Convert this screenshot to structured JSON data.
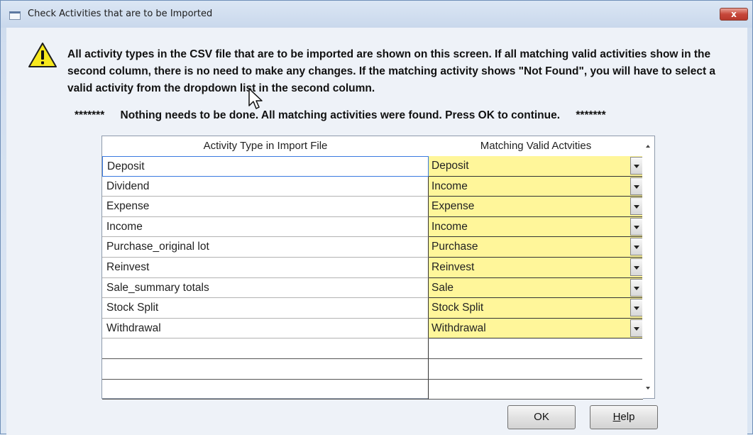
{
  "window": {
    "title": "Check Activities that are to be Imported",
    "close_label": "x"
  },
  "message": {
    "text": "All activity types in the CSV file that are to be imported are shown on this screen. If all matching valid activities show in the second column, there is no need to make any changes. If the matching activity shows \"Not Found\", you will have to select a valid activity from the dropdown list in the second column."
  },
  "status": {
    "left_stars": "*******",
    "text": "Nothing needs to be done. All matching activities were found. Press OK to continue.",
    "right_stars": "*******"
  },
  "grid": {
    "columns": [
      "Activity Type in Import File",
      "Matching Valid Actvities"
    ],
    "rows": [
      {
        "import": "Deposit",
        "match": "Deposit"
      },
      {
        "import": "Dividend",
        "match": "Income"
      },
      {
        "import": "Expense",
        "match": "Expense"
      },
      {
        "import": "Income",
        "match": "Income"
      },
      {
        "import": "Purchase_original lot",
        "match": "Purchase"
      },
      {
        "import": "Reinvest",
        "match": "Reinvest"
      },
      {
        "import": "Sale_summary totals",
        "match": "Sale"
      },
      {
        "import": "Stock Split",
        "match": "Stock Split"
      },
      {
        "import": "Withdrawal",
        "match": "Withdrawal"
      }
    ]
  },
  "buttons": {
    "ok": "OK",
    "help_underlined": "H",
    "help_rest": "elp"
  },
  "colors": {
    "match_cell_bg": "#fff69a",
    "selection_border": "#3a7ae0"
  }
}
